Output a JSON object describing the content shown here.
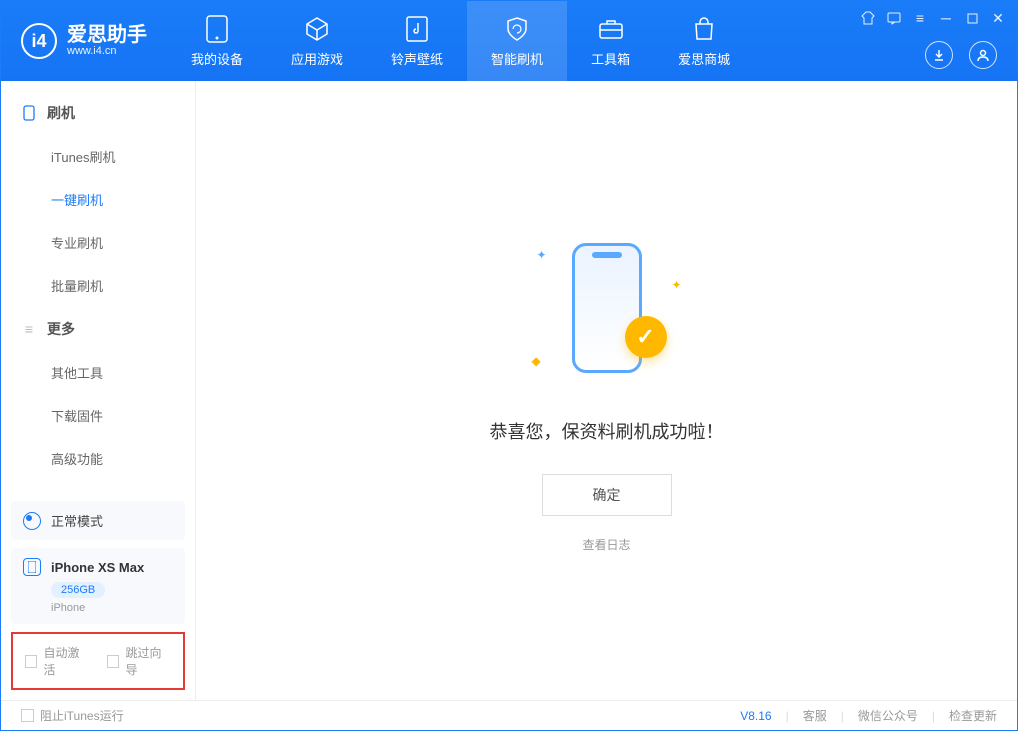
{
  "header": {
    "logo_title": "爱思助手",
    "logo_url": "www.i4.cn",
    "tabs": [
      {
        "label": "我的设备"
      },
      {
        "label": "应用游戏"
      },
      {
        "label": "铃声壁纸"
      },
      {
        "label": "智能刷机"
      },
      {
        "label": "工具箱"
      },
      {
        "label": "爱思商城"
      }
    ]
  },
  "sidebar": {
    "section1_title": "刷机",
    "items1": [
      {
        "label": "iTunes刷机"
      },
      {
        "label": "一键刷机"
      },
      {
        "label": "专业刷机"
      },
      {
        "label": "批量刷机"
      }
    ],
    "section2_title": "更多",
    "items2": [
      {
        "label": "其他工具"
      },
      {
        "label": "下载固件"
      },
      {
        "label": "高级功能"
      }
    ],
    "status_label": "正常模式",
    "device": {
      "name": "iPhone XS Max",
      "storage": "256GB",
      "type": "iPhone"
    },
    "checkbox1": "自动激活",
    "checkbox2": "跳过向导"
  },
  "main": {
    "success_text": "恭喜您，保资料刷机成功啦！",
    "ok_button": "确定",
    "log_link": "查看日志"
  },
  "footer": {
    "stop_itunes": "阻止iTunes运行",
    "version": "V8.16",
    "links": [
      "客服",
      "微信公众号",
      "检查更新"
    ]
  }
}
